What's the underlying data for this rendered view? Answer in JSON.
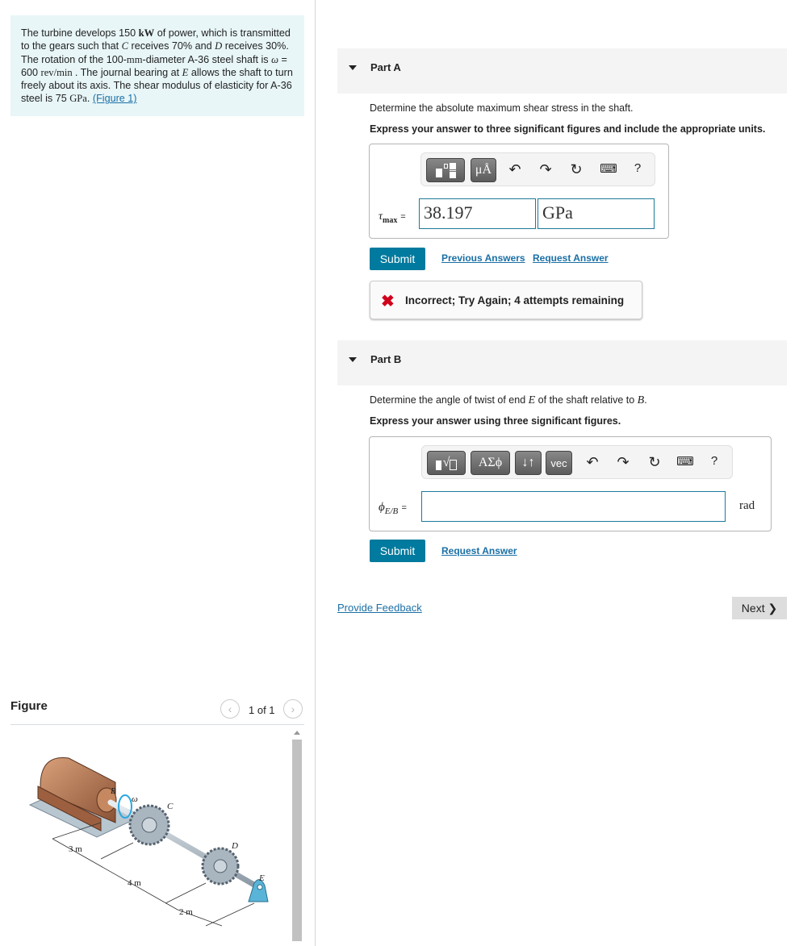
{
  "intro": {
    "t1": "The turbine develops 150 ",
    "kW": "kW",
    "t2": " of power, which is transmitted to the gears such that ",
    "C": "C",
    "t3": " receives 70% and ",
    "D": "D",
    "t4": " receives 30%. The rotation of the 100-",
    "mm": "mm",
    "t5": "-diameter A-36 steel shaft is ",
    "omega": "ω",
    "t6": " = 600 ",
    "rev": " rev/min ",
    "t7": ". The journal bearing at ",
    "E": "E",
    "t8": " allows the shaft to turn freely about its axis. The shear modulus of elasticity for A-36 steel is 75 ",
    "GPa": "GPa",
    "t9": ". ",
    "fig_link": "(Figure 1)"
  },
  "partA": {
    "title": "Part A",
    "question": "Determine the absolute maximum shear stress in the shaft.",
    "instruction": "Express your answer to three significant figures and include the appropriate units.",
    "var": "τ",
    "var_sub": "max",
    "eq": "=",
    "value": "38.197",
    "units": "GPa",
    "unit_btn": "μÅ",
    "submit": "Submit",
    "prev": "Previous Answers",
    "request": "Request Answer",
    "feedback": "Incorrect; Try Again; 4 attempts remaining",
    "help": "?"
  },
  "partB": {
    "title": "Part B",
    "q1": "Determine the angle of twist of end ",
    "E": "E",
    "q2": " of the shaft relative to ",
    "B": "B",
    "q3": ".",
    "instruction": "Express your answer using three significant figures.",
    "var": "ϕ",
    "var_sub": "E/B",
    "eq": "=",
    "value": "",
    "unit": "rad",
    "greek_btn": "ΑΣϕ",
    "sort_btn": "↓↑",
    "vec_btn": "vec",
    "submit": "Submit",
    "request": "Request Answer",
    "help": "?"
  },
  "footer": {
    "feedback": "Provide Feedback",
    "next": "Next ❯"
  },
  "figure": {
    "title": "Figure",
    "pager": "1 of 1",
    "prev": "‹",
    "next": "›",
    "labels": {
      "B": "B",
      "C": "C",
      "D": "D",
      "E": "E",
      "omega": "ω",
      "d1": "3 m",
      "d2": "4 m",
      "d3": "2 m"
    }
  },
  "colors": {
    "accent": "#007a9e",
    "error": "#d0021b",
    "intro_bg": "#e8f6f8"
  }
}
